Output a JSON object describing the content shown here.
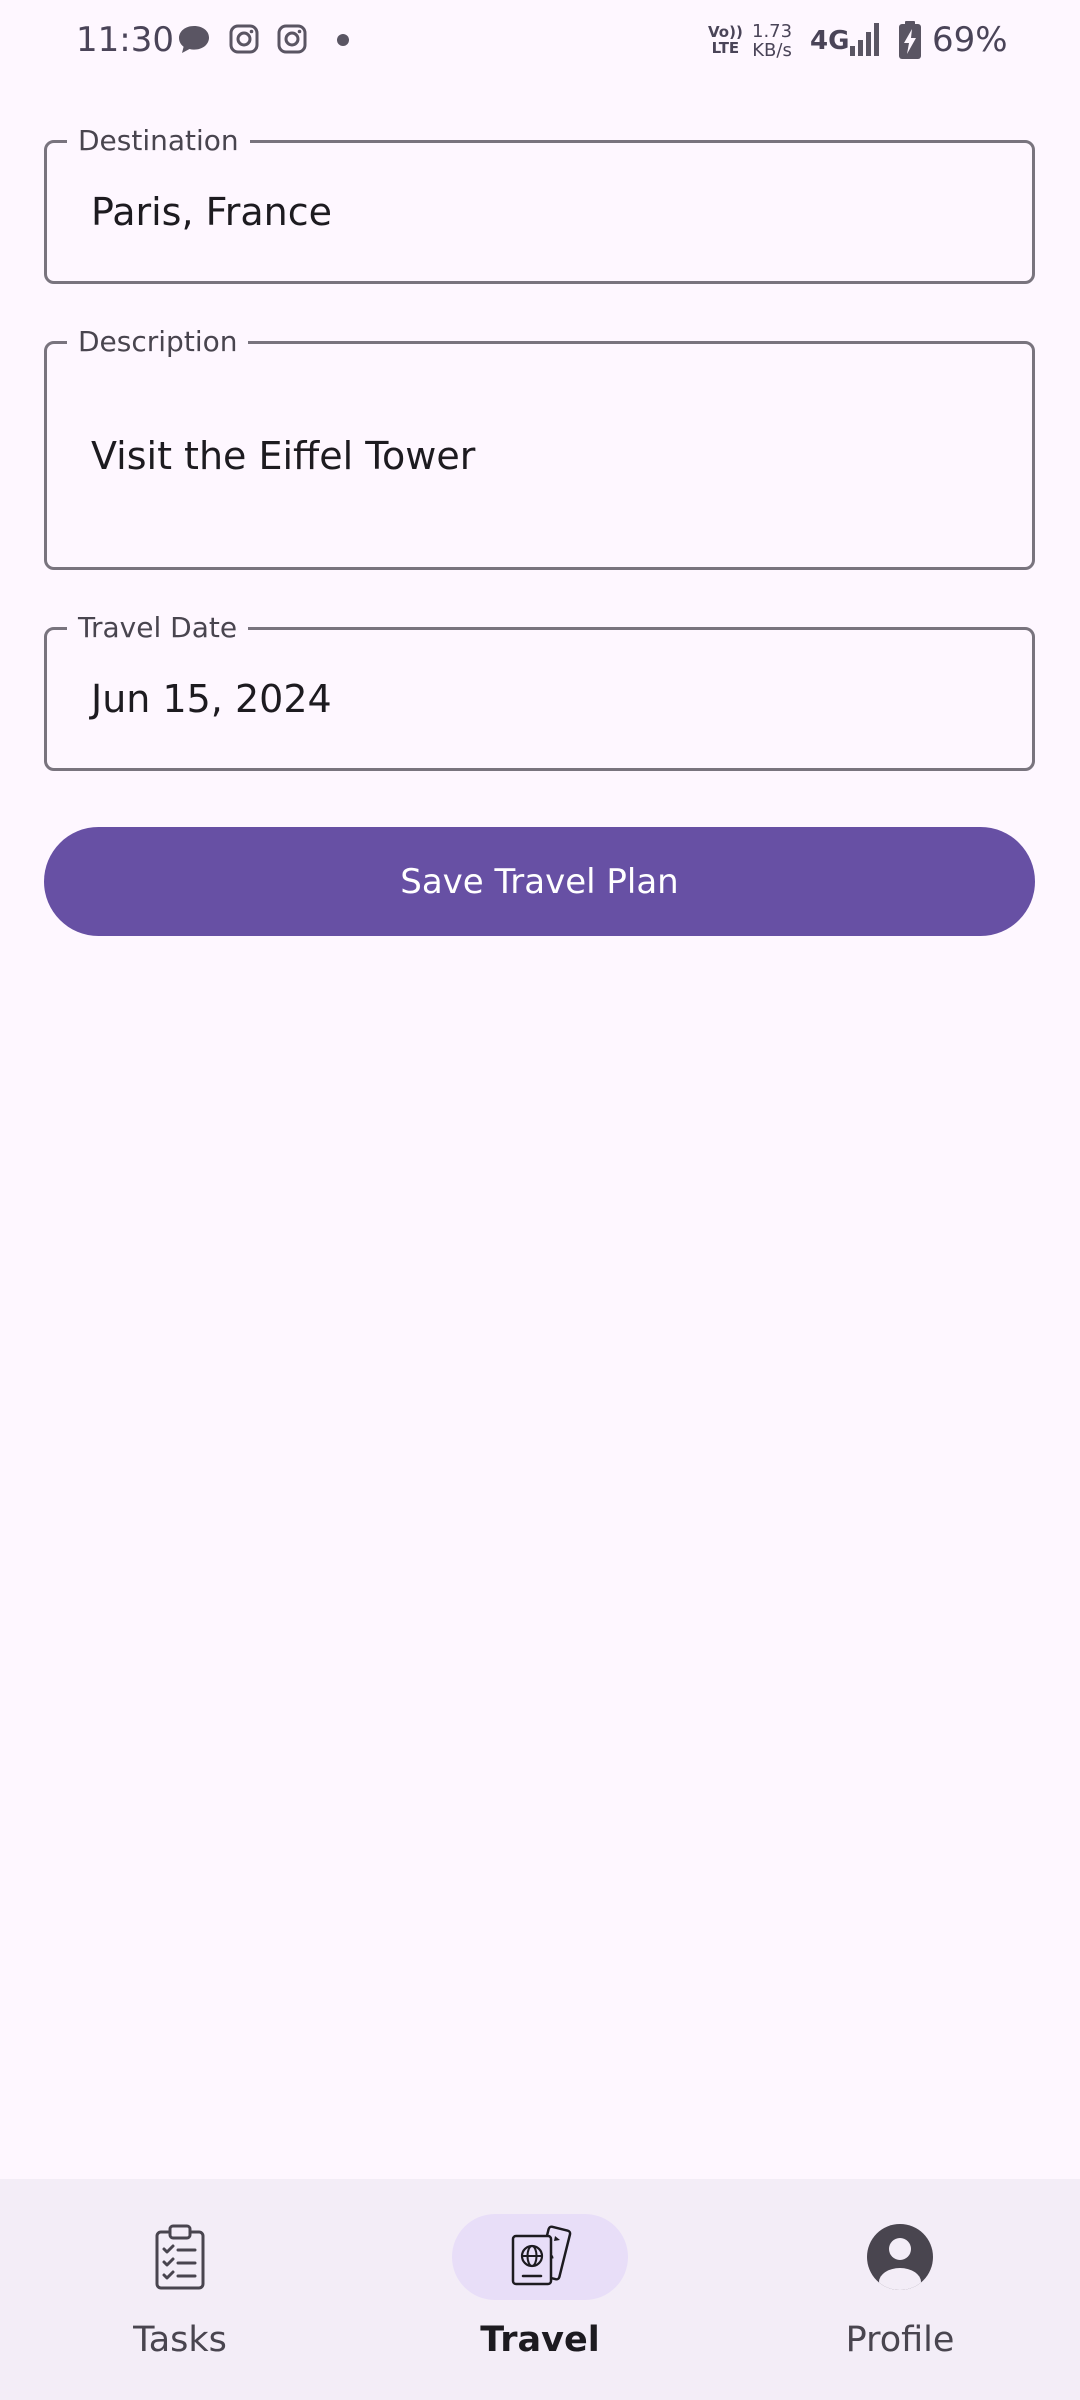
{
  "status_bar": {
    "time": "11:30",
    "notification_icons": [
      "chat-bubble-icon",
      "instagram-icon",
      "instagram-icon",
      "dot-icon"
    ],
    "volte_line1": "Vo))",
    "volte_line2": "LTE",
    "net_speed_value": "1.73",
    "net_speed_unit": "KB/s",
    "network_type": "4G",
    "battery_percent": "69%"
  },
  "form": {
    "destination": {
      "label": "Destination",
      "value": "Paris, France"
    },
    "description": {
      "label": "Description",
      "value": "Visit the Eiffel Tower"
    },
    "travel_date": {
      "label": "Travel Date",
      "value": "Jun 15, 2024"
    },
    "save_label": "Save Travel Plan"
  },
  "bottom_nav": {
    "items": [
      {
        "label": "Tasks",
        "icon": "clipboard-checklist-icon",
        "selected": false
      },
      {
        "label": "Travel",
        "icon": "passport-ticket-icon",
        "selected": true
      },
      {
        "label": "Profile",
        "icon": "account-circle-icon",
        "selected": false
      }
    ]
  },
  "colors": {
    "background": "#FEF7FF",
    "primary": "#6750A4",
    "outline": "#79747E",
    "nav_background": "#F3EDF7",
    "nav_indicator": "#E8DEF8"
  }
}
